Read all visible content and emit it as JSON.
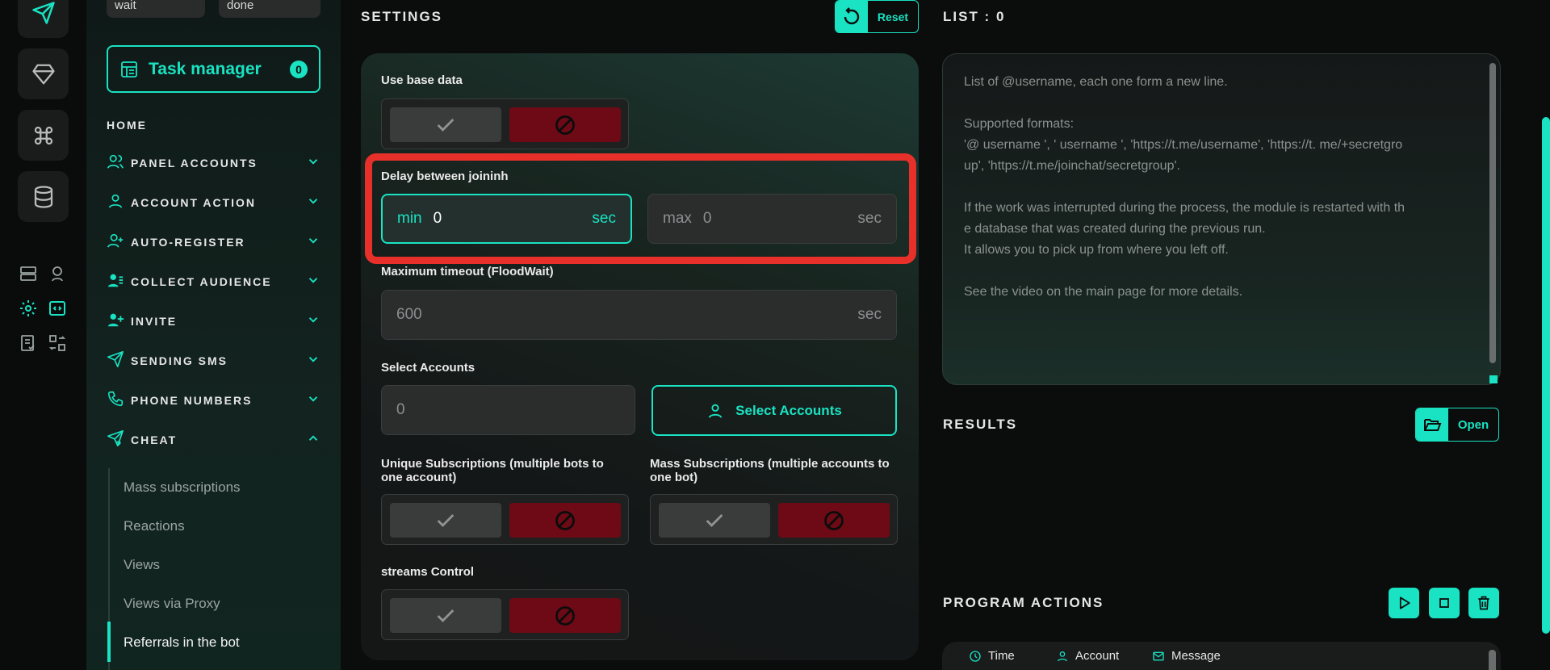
{
  "colors": {
    "accent": "#19e3c2",
    "danger": "#6e0a15",
    "highlight": "#e8302a"
  },
  "status_pills": [
    "wait",
    "done"
  ],
  "task_manager": {
    "label": "Task manager",
    "count": "0"
  },
  "sidebar": {
    "home": "HOME",
    "items": [
      {
        "label": "PANEL ACCOUNTS",
        "icon": "users-icon",
        "expanded": false
      },
      {
        "label": "ACCOUNT ACTION",
        "icon": "user-icon",
        "expanded": false
      },
      {
        "label": "AUTO-REGISTER",
        "icon": "user-plus-icon",
        "expanded": false
      },
      {
        "label": "COLLECT AUDIENCE",
        "icon": "user-list-icon",
        "expanded": false
      },
      {
        "label": "INVITE",
        "icon": "user-add-icon",
        "expanded": false
      },
      {
        "label": "SENDING SMS",
        "icon": "send-icon",
        "expanded": false
      },
      {
        "label": "PHONE NUMBERS",
        "icon": "phone-icon",
        "expanded": false
      },
      {
        "label": "CHEAT",
        "icon": "send-heart-icon",
        "expanded": true
      }
    ],
    "subitems": [
      "Mass subscriptions",
      "Reactions",
      "Views",
      "Views via Proxy",
      "Referrals in the bot"
    ],
    "active_subitem": "Referrals in the bot"
  },
  "settings": {
    "title": "SETTINGS",
    "reset_label": "Reset",
    "use_base_data": "Use base data",
    "delay_label": "Delay between joininh",
    "delay_min": {
      "prefix": "min",
      "value": "0",
      "suffix": "sec"
    },
    "delay_max": {
      "prefix": "max",
      "value": "0",
      "suffix": "sec"
    },
    "timeout_label": "Maximum timeout (FloodWait)",
    "timeout": {
      "value": "600",
      "suffix": "sec"
    },
    "select_accounts_label": "Select Accounts",
    "select_accounts_value": "0",
    "select_accounts_button": "Select Accounts",
    "unique_subs_label": "Unique Subscriptions (multiple bots to one account)",
    "mass_subs_label": "Mass Subscriptions (multiple accounts to one bot)",
    "streams_label": "streams Control"
  },
  "list": {
    "title": "LIST : 0",
    "lines": [
      "List of @username, each one form a new line.",
      "",
      "Supported formats:",
      "'@ username ', ' username ', 'https://t.me/username', 'https://t. me/+secretgro",
      "up', 'https://t.me/joinchat/secretgroup'.",
      "",
      "If the work was interrupted during the process, the module is restarted with th",
      "e database that was created during the previous run.",
      "It allows you to pick up from where you left off.",
      "",
      "See the video on the main page for more details."
    ]
  },
  "results": {
    "title": "RESULTS",
    "open_label": "Open"
  },
  "program_actions": {
    "title": "PROGRAM ACTIONS",
    "columns": [
      "Time",
      "Account",
      "Message"
    ]
  }
}
